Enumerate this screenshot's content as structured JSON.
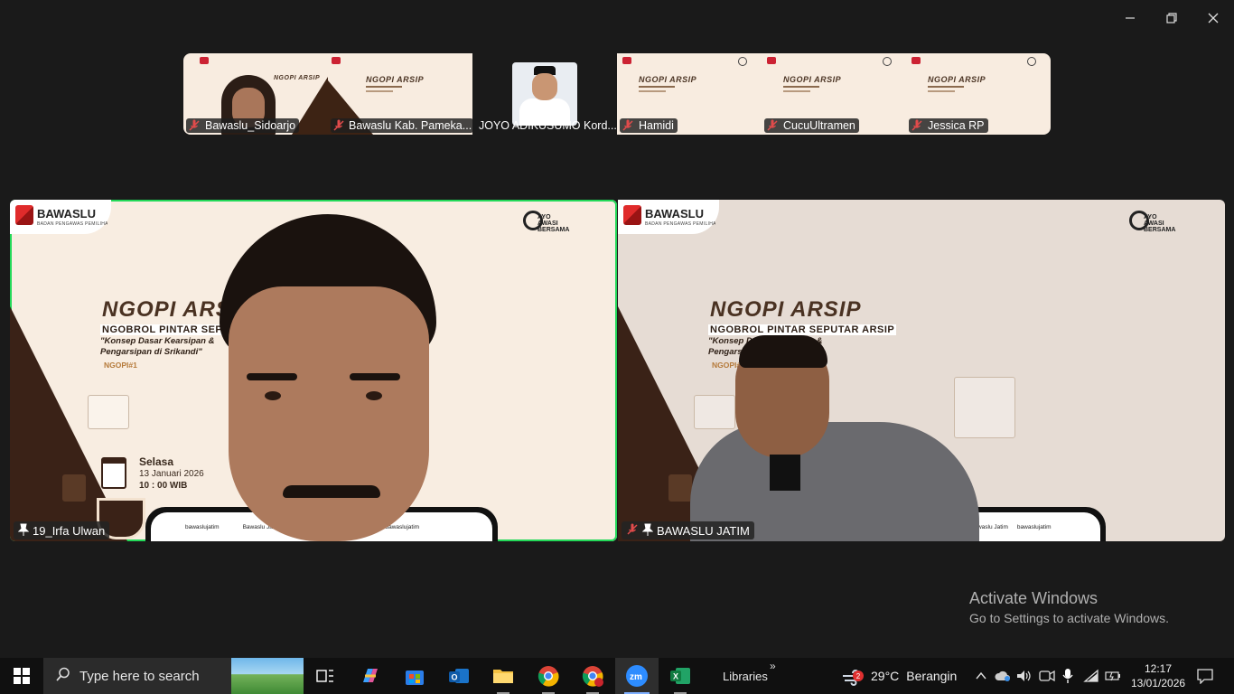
{
  "window": {
    "minimize": "—",
    "restore": "❐",
    "close": "✕"
  },
  "gallery": [
    {
      "name": "Bawaslu_Sidoarjo",
      "muted": true,
      "kind": "face"
    },
    {
      "name": "Bawaslu Kab. Pameka...",
      "muted": true,
      "kind": "poster"
    },
    {
      "name": "JOYO ADIKUSUMO Kord...",
      "muted": false,
      "kind": "photo"
    },
    {
      "name": "Hamidi",
      "muted": true,
      "kind": "poster"
    },
    {
      "name": "CucuUltramen",
      "muted": true,
      "kind": "poster"
    },
    {
      "name": "Jessica RP",
      "muted": true,
      "kind": "poster"
    }
  ],
  "poster": {
    "org": "BAWASLU",
    "org_sub": "BADAN PENGAWAS PEMILIHAN UMUM PROVINSI JAWA TIMUR",
    "ayo": "AYO AWASI BERSAMA",
    "title": "NGOPI ARSIP",
    "subtitle": "NGOBROL PINTAR SEPUTAR ARSIP",
    "topic_line1": "\"Konsep Dasar Kearsipan &",
    "topic_line2": "Pengarsipan di Srikandi\"",
    "episode": "NGOPI#1",
    "day": "Selasa",
    "date": "13 Januari 2026",
    "time": "10 : 00 WIB",
    "social1": "bawaslujatim",
    "social2": "Bawaslu Jatim",
    "social3": "bawaslujatim"
  },
  "main": {
    "left_name": "19_Irfa Ulwan",
    "right_name": "BAWASLU JATIM",
    "active_speaker_color": "#23d959"
  },
  "watermark": {
    "line1": "Activate Windows",
    "line2": "Go to Settings to activate Windows."
  },
  "taskbar": {
    "search_placeholder": "Type here to search",
    "libraries": "Libraries",
    "chevron": "»",
    "weather_temp": "29°C",
    "weather_desc": "Berangin",
    "weather_badge": "2",
    "time": "12:17",
    "date": "13/01/2026"
  }
}
